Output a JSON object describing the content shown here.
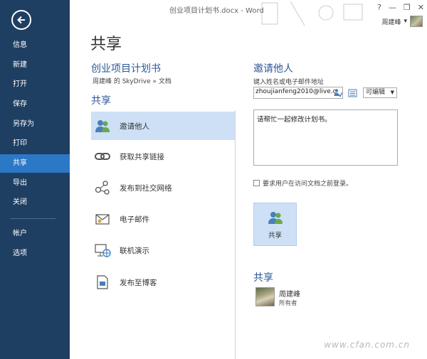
{
  "titlebar": {
    "doc_title": "创业项目计划书.docx - Word",
    "help": "?",
    "minimize": "—",
    "restore": "❐",
    "close": "✕",
    "user_name": "周建峰",
    "user_caret": "▾"
  },
  "nav": {
    "items": [
      {
        "label": "信息"
      },
      {
        "label": "新建"
      },
      {
        "label": "打开"
      },
      {
        "label": "保存"
      },
      {
        "label": "另存为"
      },
      {
        "label": "打印"
      },
      {
        "label": "共享"
      },
      {
        "label": "导出"
      },
      {
        "label": "关闭"
      },
      {
        "label": "帐户"
      },
      {
        "label": "选项"
      }
    ],
    "active": "共享"
  },
  "page": {
    "title": "共享",
    "doc_name": "创业项目计划书",
    "doc_path": "周建峰 的 SkyDrive » 文档",
    "share_heading": "共享"
  },
  "share_options": [
    {
      "label": "邀请他人",
      "icon": "people-icon"
    },
    {
      "label": "获取共享链接",
      "icon": "link-icon"
    },
    {
      "label": "发布到社交网络",
      "icon": "social-network-icon"
    },
    {
      "label": "电子邮件",
      "icon": "email-icon"
    },
    {
      "label": "联机演示",
      "icon": "online-presentation-icon"
    },
    {
      "label": "发布至博客",
      "icon": "blog-icon"
    }
  ],
  "invite": {
    "title": "邀请他人",
    "hint": "键入姓名或电子邮件地址",
    "email_value": "zhoujianfeng2010@live.c",
    "permission": "可编辑",
    "message": "请帮忙一起修改计划书。",
    "require_signin": "要求用户在访问文档之前登录。",
    "share_button": "共享"
  },
  "shared_with": {
    "title": "共享",
    "owner_name": "周建峰",
    "owner_role": "所有者"
  },
  "watermark": "www.cfan.com.cn",
  "colors": {
    "nav_bg": "#1e3f62",
    "nav_active": "#2b78c7",
    "accent_text": "#2b5797",
    "selection": "#cde0f5"
  }
}
